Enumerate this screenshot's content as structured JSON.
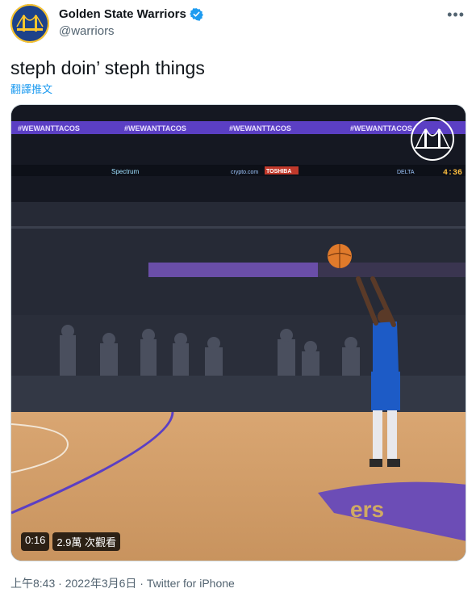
{
  "author": {
    "display_name": "Golden State Warriors",
    "handle": "@warriors",
    "avatar_icon": "warriors-bridge-logo",
    "verified_icon": "verified-badge-icon"
  },
  "tweet": {
    "text": "steph doin’ steph things",
    "translate_label": "翻譯推文"
  },
  "video": {
    "duration": "0:16",
    "views": "2.9萬 次觀看",
    "arena_banner": "#WEWANTTACOS",
    "scoreboard": {
      "sponsor1": "Spectrum",
      "sponsor2": "crypto.com",
      "sponsor3": "TOSHIBA",
      "sponsor4": "DELTA",
      "clock": "4:36"
    }
  },
  "footer": {
    "time": "上午8:43",
    "separator": " · ",
    "date": "2022年3月6日",
    "source": "Twitter for iPhone"
  },
  "colors": {
    "accent": "#1d9bf0",
    "warriors_blue": "#1d428a",
    "warriors_gold": "#ffc72c",
    "lakers_purple": "#552583"
  }
}
